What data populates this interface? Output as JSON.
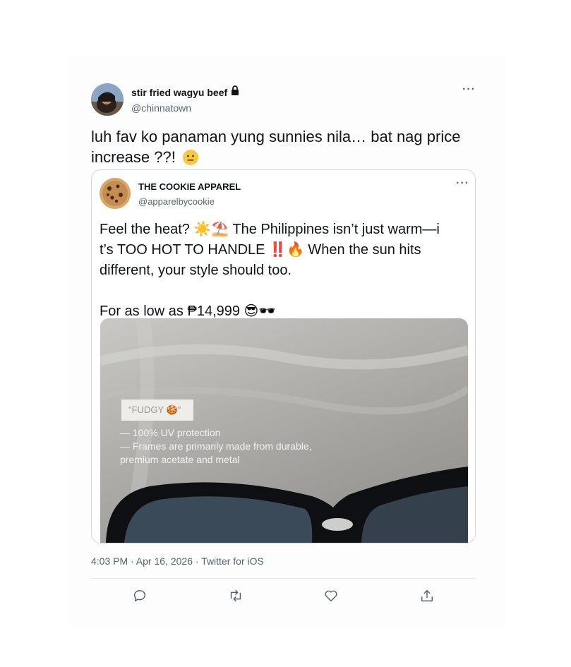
{
  "tweet": {
    "display_name": "stir fried wagyu beef",
    "handle": "@chinnatown",
    "text": "luh fav ko panaman yung sunnies nila… bat nag price increase ??!",
    "emoji": "neutral-face-emoji",
    "timestamp": "4:03 PM · Apr 16, 2026 · ",
    "source": "Twitter for iOS",
    "locked": true
  },
  "quote": {
    "display_name": "THE COOKIE APPAREL",
    "handle": "@apparelbycookie",
    "line1": "Feel the heat? ☀️⛱️ The Philippines isn’t just warm—i",
    "line2": " t’s TOO HOT TO HANDLE ‼️🔥 When the sun hits",
    "line3": "different, your style should too.",
    "line4": "For as low as ₱14,999 😎🕶️",
    "media": {
      "tag": "\"FUDGY 🍪\"",
      "spec1": "— 100% UV protection",
      "spec2": "— Frames are primarily made from durable,",
      "spec3": "premium acetate and metal"
    }
  },
  "actions": [
    {
      "name": "reply",
      "icon": "reply-icon"
    },
    {
      "name": "retweet",
      "icon": "retweet-icon"
    },
    {
      "name": "like",
      "icon": "heart-icon"
    },
    {
      "name": "share",
      "icon": "share-icon"
    }
  ],
  "colors": {
    "text": "#0f1419",
    "secondary": "#536471",
    "border": "#cfd9de"
  }
}
